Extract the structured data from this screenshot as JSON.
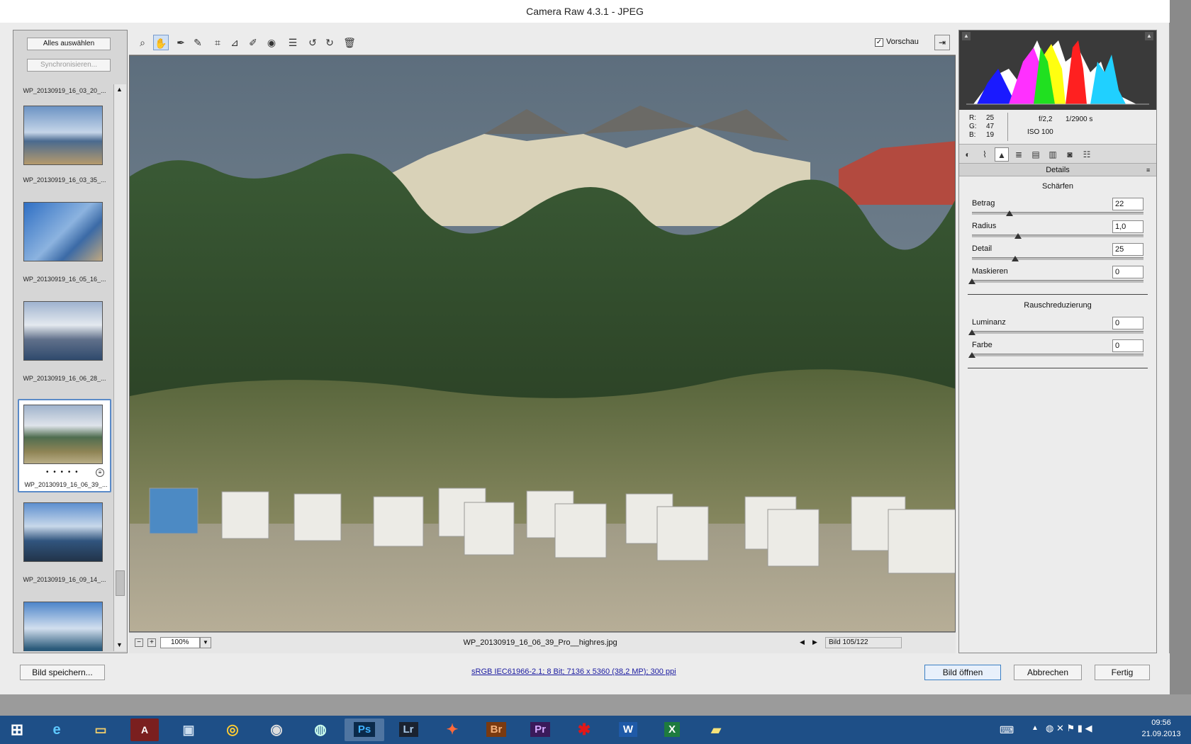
{
  "window": {
    "title": "Camera Raw 4.3.1 - JPEG"
  },
  "filmstrip": {
    "select_all": "Alles auswählen",
    "synchronize": "Synchronisieren...",
    "items": [
      {
        "name": "WP_20130919_16_03_20_..."
      },
      {
        "name": "WP_20130919_16_03_35_..."
      },
      {
        "name": "WP_20130919_16_05_16_..."
      },
      {
        "name": "WP_20130919_16_06_28_..."
      },
      {
        "name": "WP_20130919_16_06_39_...",
        "selected": true,
        "rating": "• • • • •"
      },
      {
        "name": "WP_20130919_16_09_14_..."
      }
    ]
  },
  "toolbar": {
    "preview_label": "Vorschau",
    "preview_checked": true
  },
  "status": {
    "zoom": "100%",
    "filename": "WP_20130919_16_06_39_Pro__highres.jpg",
    "image_count": "Bild 105/122"
  },
  "info": {
    "r_label": "R:",
    "r": "25",
    "g_label": "G:",
    "g": "47",
    "b_label": "B:",
    "b": "19",
    "aperture": "f/2,2",
    "shutter": "1/2900 s",
    "iso": "ISO 100"
  },
  "panel": {
    "title": "Details",
    "sharpen_header": "Schärfen",
    "noise_header": "Rauschreduzierung",
    "sharpen": [
      {
        "label": "Betrag",
        "value": "22",
        "level": 0.22
      },
      {
        "label": "Radius",
        "value": "1,0",
        "level": 0.27
      },
      {
        "label": "Detail",
        "value": "25",
        "level": 0.25
      },
      {
        "label": "Maskieren",
        "value": "0",
        "level": 0
      }
    ],
    "noise": [
      {
        "label": "Luminanz",
        "value": "0",
        "level": 0
      },
      {
        "label": "Farbe",
        "value": "0",
        "level": 0
      }
    ]
  },
  "bottom": {
    "save": "Bild speichern...",
    "colorinfo": "sRGB IEC61966-2.1; 8 Bit; 7136 x 5360 (38,2 MP); 300 ppi",
    "open": "Bild öffnen",
    "cancel": "Abbrechen",
    "done": "Fertig"
  },
  "taskbar": {
    "apps": [
      "start",
      "ie",
      "explorer",
      "acrobat",
      "photos",
      "chrome",
      "dvd",
      "app",
      "Ps",
      "Lr",
      "app2",
      "Br",
      "Pr",
      "app3",
      "W",
      "X",
      "app4"
    ],
    "time": "09:56",
    "date": "21.09.2013"
  },
  "colors": {
    "accent": "#3b7fc4",
    "taskbar": "#1e4f87"
  }
}
